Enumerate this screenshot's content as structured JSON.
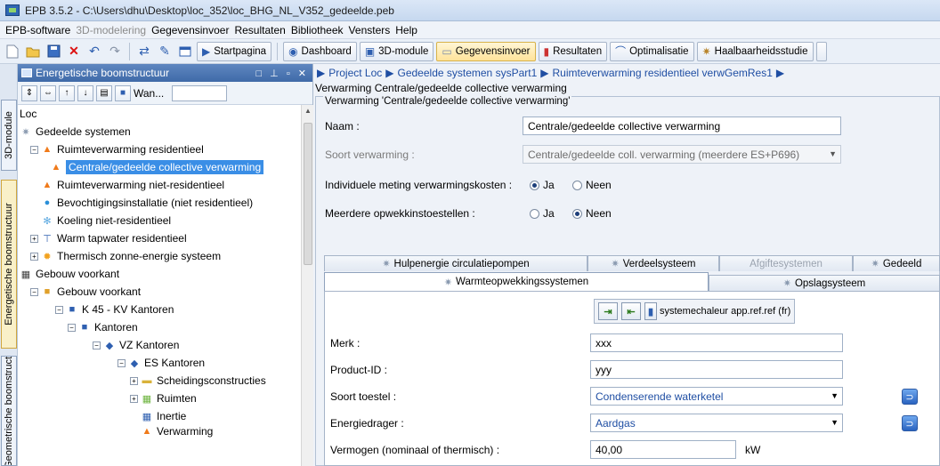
{
  "window": {
    "title": "EPB 3.5.2 - C:\\Users\\dhu\\Desktop\\loc_352\\loc_BHG_NL_V352_gedeelde.peb"
  },
  "menu": [
    {
      "label": "EPB-software",
      "disabled": false
    },
    {
      "label": "3D-modelering",
      "disabled": true
    },
    {
      "label": "Gegevensinvoer",
      "disabled": false
    },
    {
      "label": "Resultaten",
      "disabled": false
    },
    {
      "label": "Bibliotheek",
      "disabled": false
    },
    {
      "label": "Vensters",
      "disabled": false
    },
    {
      "label": "Help",
      "disabled": false
    }
  ],
  "toolbar": {
    "startpagina": "Startpagina",
    "dashboard": "Dashboard",
    "module3d": "3D-module",
    "gegevensinvoer": "Gegevensinvoer",
    "resultaten": "Resultaten",
    "optimalisatie": "Optimalisatie",
    "haalbaarheid": "Haalbaarheidsstudie"
  },
  "vtabs": {
    "module3d": "3D-module",
    "energetisch": "Energetische boomstructuur",
    "geometrisch": "Geometrische boomstructuur"
  },
  "leftpanel": {
    "title": "Energetische boomstructuur",
    "wan": "Wan..."
  },
  "tree": [
    {
      "label": "Loc",
      "icon": "none"
    },
    {
      "label": "Gedeelde systemen",
      "icon": "gear-icon"
    },
    {
      "label": "Ruimteverwarming residentieel",
      "icon": "flame-icon"
    },
    {
      "label": "Centrale/gedeelde collective verwarming",
      "icon": "flame-icon",
      "selected": true
    },
    {
      "label": "Ruimteverwarming niet-residentieel",
      "icon": "flame-icon"
    },
    {
      "label": "Bevochtigingsinstallatie (niet residentieel)",
      "icon": "drop-icon"
    },
    {
      "label": "Koeling niet-residentieel",
      "icon": "snowflake-icon"
    },
    {
      "label": "Warm tapwater residentieel",
      "icon": "tap-icon"
    },
    {
      "label": "Thermisch zonne-energie systeem",
      "icon": "sun-icon"
    },
    {
      "label": "Gebouw voorkant",
      "icon": "building-icon"
    },
    {
      "label": "Gebouw voorkant",
      "icon": "building-icon"
    },
    {
      "label": "K 45 - KV Kantoren",
      "icon": "k-icon"
    },
    {
      "label": "Kantoren",
      "icon": "cube-icon"
    },
    {
      "label": "VZ Kantoren",
      "icon": "v-icon"
    },
    {
      "label": "ES Kantoren",
      "icon": "es-icon"
    },
    {
      "label": "Scheidingsconstructies",
      "icon": "wall-icon"
    },
    {
      "label": "Ruimten",
      "icon": "room-icon"
    },
    {
      "label": "Inertie",
      "icon": "inertia-icon"
    },
    {
      "label": "Verwarming",
      "icon": "flame-icon"
    }
  ],
  "breadcrumb": {
    "items": [
      "Project Loc",
      "Gedeelde systemen sysPart1",
      "Ruimteverwarming residentieel verwGemRes1"
    ],
    "line2": "Verwarming Centrale/gedeelde collective verwarming"
  },
  "group": {
    "title": "Verwarming 'Centrale/gedeelde collective verwarming'"
  },
  "form": {
    "naam_label": "Naam :",
    "naam_value": "Centrale/gedeelde collective verwarming",
    "soort_label": "Soort verwarming :",
    "soort_value": "Centrale/gedeelde coll. verwarming (meerdere ES+P696)",
    "meting_label": "Individuele meting verwarmingskosten :",
    "meting_ja": "Ja",
    "meting_neen": "Neen",
    "opwek_label": "Meerdere opwekkinstoestellen :",
    "opwek_ja": "Ja",
    "opwek_neen": "Neen"
  },
  "tabs": {
    "row1": [
      "Hulpenergie circulatiepompen",
      "Verdeelsysteem",
      "Afgiftesystemen",
      "Gedeeld"
    ],
    "row2": [
      "Warmteopwekkingssystemen",
      "Opslagsysteem"
    ]
  },
  "product": {
    "library_text": "systemechaleur app.ref.ref (fr)",
    "merk_label": "Merk :",
    "merk_value": "xxx",
    "productid_label": "Product-ID :",
    "productid_value": "yyy",
    "toestel_label": "Soort toestel :",
    "toestel_value": "Condenserende waterketel",
    "drager_label": "Energiedrager :",
    "drager_value": "Aardgas",
    "vermogen_label": "Vermogen (nominaal of thermisch) :",
    "vermogen_value": "40,00",
    "vermogen_unit": "kW"
  },
  "colors": {
    "link": "#1f4ea3",
    "selection": "#3a8ee6",
    "panel_header": "#4a74b2"
  }
}
